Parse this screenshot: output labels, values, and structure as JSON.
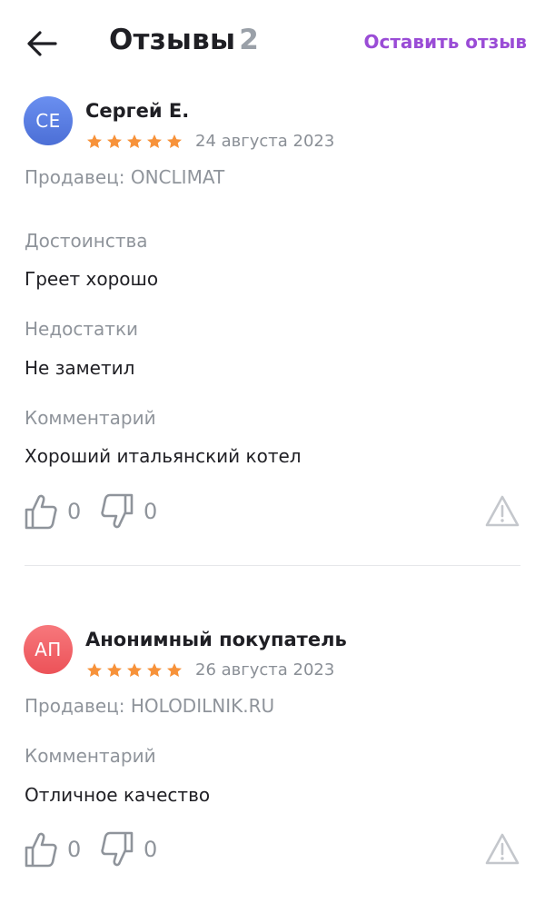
{
  "header": {
    "back_icon": "arrow-left-icon",
    "title": "Отзывы",
    "count": "2",
    "leave_review_label": "Оставить отзыв",
    "accent_color": "#9a4cd6"
  },
  "reviews": [
    {
      "avatar_initials": "СЕ",
      "avatar_color": "#5b7fe0",
      "author": "Сергей Е.",
      "rating": 5,
      "date": "24 августа 2023",
      "seller": "Продавец: ONCLIMAT",
      "sections": [
        {
          "label": "Достоинства",
          "text": "Греет хорошо"
        },
        {
          "label": "Недостатки",
          "text": "Не заметил"
        },
        {
          "label": "Комментарий",
          "text": "Хороший итальянский котел"
        }
      ],
      "likes": "0",
      "dislikes": "0",
      "report_icon": "warning-icon"
    },
    {
      "avatar_initials": "АП",
      "avatar_color": "#f1646a",
      "author": "Анонимный покупатель",
      "rating": 5,
      "date": "26 августа 2023",
      "seller": "Продавец: HOLODILNIK.RU",
      "sections": [
        {
          "label": "Комментарий",
          "text": "Отличное качество"
        }
      ],
      "likes": "0",
      "dislikes": "0",
      "report_icon": "warning-icon"
    }
  ],
  "star_color": "#f7923a"
}
